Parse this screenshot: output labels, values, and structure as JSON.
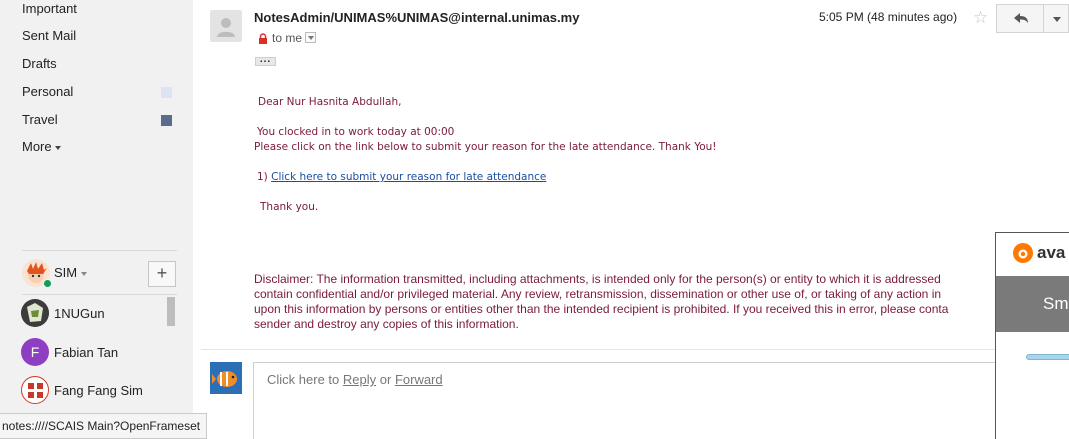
{
  "sidebar": {
    "labels": [
      {
        "label": "Important"
      },
      {
        "label": "Sent Mail"
      },
      {
        "label": "Drafts"
      },
      {
        "label": "Personal",
        "color": "#dce3f3"
      },
      {
        "label": "Travel",
        "color": "#5a6b8c"
      }
    ],
    "more_label": "More"
  },
  "hangouts": {
    "user_label": "SIM",
    "add_label": "+",
    "contacts": [
      {
        "name": "1NUGun"
      },
      {
        "name": "Fabian Tan",
        "initial": "F",
        "color": "#8e3ec0"
      },
      {
        "name": "Fang Fang Sim"
      }
    ]
  },
  "status_url": "notes:////SCAIS Main?OpenFrameset",
  "message": {
    "sender": "NotesAdmin/UNIMAS%UNIMAS@internal.unimas.my",
    "to_label": "to me",
    "timestamp": "5:05 PM (48 minutes ago)",
    "greeting": "Dear Nur Hasnita Abdullah,",
    "clock_line": "You clocked in to work today at  00:00",
    "instruction": "Please click on the link below to submit your reason for the late attendance. Thank You!",
    "link_prefix": "1)",
    "link_text": "Click here to submit your reason for late attendance",
    "thanks": "Thank you.",
    "disclaimer_lines": [
      "Disclaimer: The information transmitted, including attachments, is intended only for the person(s) or entity to which it is addressed",
      "contain confidential and/or privileged material. Any review, retransmission, dissemination or other use of, or taking of any action in",
      "upon this information by persons or entities other than the intended recipient is prohibited. If you received this in error, please conta",
      "sender and destroy any copies of this information."
    ]
  },
  "reply": {
    "prefix": "Click here to",
    "reply_label": "Reply",
    "or_label": "or",
    "forward_label": "Forward"
  },
  "avast": {
    "brand": "ava",
    "band_text": "Sm",
    "accent": "#ff7800"
  }
}
